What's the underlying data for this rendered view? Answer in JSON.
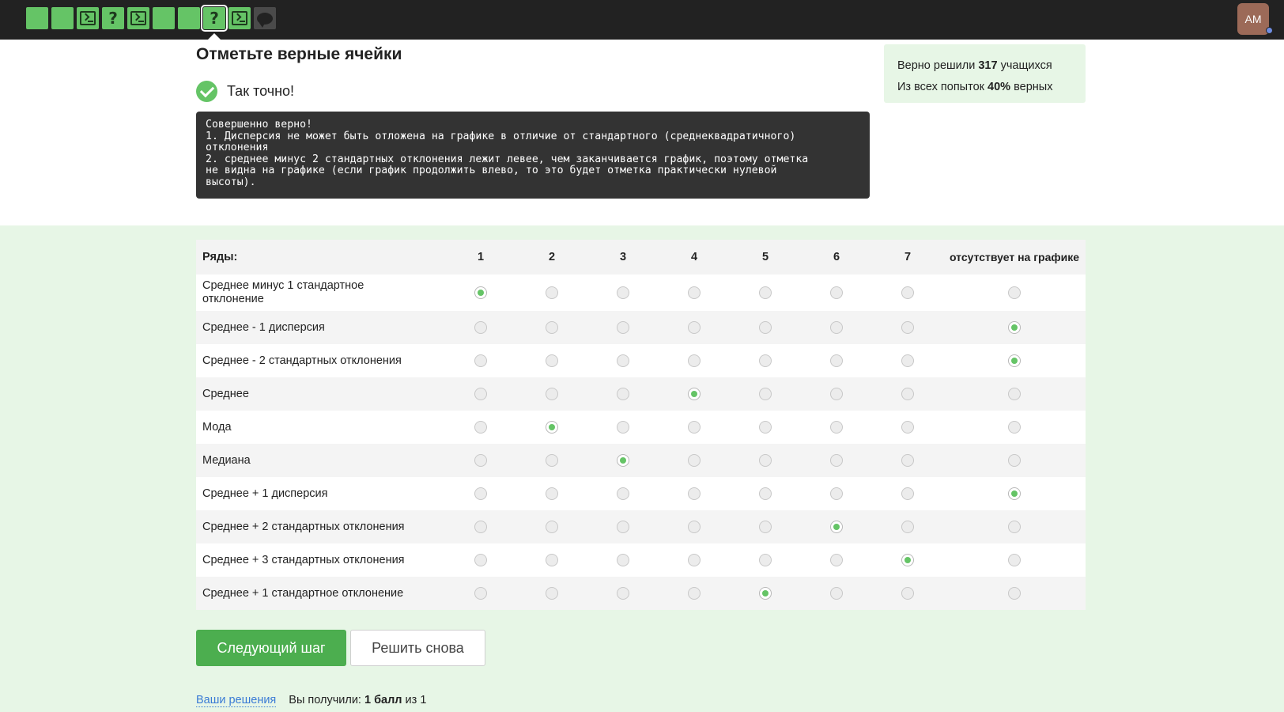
{
  "topbar": {
    "steps": [
      {
        "kind": "plain",
        "state": "done"
      },
      {
        "kind": "plain",
        "state": "done"
      },
      {
        "kind": "terminal-icon",
        "state": "done"
      },
      {
        "kind": "question-icon",
        "state": "done",
        "glyph": "?"
      },
      {
        "kind": "terminal-icon",
        "state": "done"
      },
      {
        "kind": "plain",
        "state": "done"
      },
      {
        "kind": "plain",
        "state": "done"
      },
      {
        "kind": "question-icon",
        "state": "current",
        "glyph": "?"
      },
      {
        "kind": "terminal-icon",
        "state": "done"
      },
      {
        "kind": "chat-icon",
        "state": "pending"
      }
    ],
    "avatar_initials": "AM"
  },
  "task": {
    "title": "Отметьте верные ячейки",
    "result_text": "Так точно!",
    "feedback": "Совершенно верно!\n1. Дисперсия не может быть отложена на графике в отличие от стандартного (среднеквадратичного)\nотклонения\n2. среднее минус 2 стандартных отклонения лежит левее, чем заканчивается график, поэтому отметка\nне видна на графике (если график продолжить влево, то это будет отметка практически нулевой\nвысоты)."
  },
  "stats": {
    "line1_prefix": "Верно решили ",
    "line1_value": "317",
    "line1_suffix": " учащихся",
    "line2_prefix": "Из всех попыток ",
    "line2_value": "40%",
    "line2_suffix": " верных"
  },
  "matrix": {
    "row_header": "Ряды:",
    "columns": [
      "1",
      "2",
      "3",
      "4",
      "5",
      "6",
      "7",
      "отсутствует на графике"
    ],
    "rows": [
      {
        "label": "Среднее минус 1 стандартное отклонение",
        "selected": 0
      },
      {
        "label": "Среднее - 1 дисперсия",
        "selected": 7
      },
      {
        "label": "Среднее - 2 стандартных отклонения",
        "selected": 7
      },
      {
        "label": "Среднее",
        "selected": 3
      },
      {
        "label": "Мода",
        "selected": 1
      },
      {
        "label": "Медиана",
        "selected": 2
      },
      {
        "label": "Среднее + 1 дисперсия",
        "selected": 7
      },
      {
        "label": "Среднее + 2 стандартных отклонения",
        "selected": 5
      },
      {
        "label": "Среднее + 3 стандартных отклонения",
        "selected": 6
      },
      {
        "label": "Среднее + 1 стандартное отклонение",
        "selected": 4
      }
    ]
  },
  "buttons": {
    "next": "Следующий шаг",
    "retry": "Решить снова"
  },
  "footer": {
    "link": "Ваши решения",
    "score_prefix": "Вы получили: ",
    "score_value": "1 балл",
    "score_suffix": " из 1"
  },
  "colors": {
    "accent": "#65c466",
    "button": "#4cae4f",
    "topbar": "#222222",
    "panel_bg": "#e7f6e6",
    "feedback_bg": "#333333"
  }
}
